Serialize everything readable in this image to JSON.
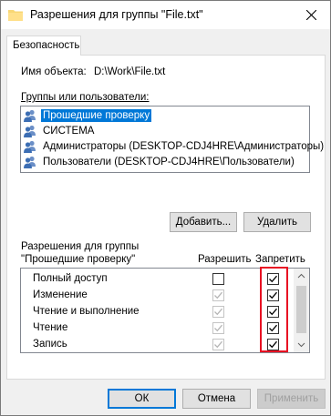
{
  "window": {
    "title": "Разрешения для группы \"File.txt\""
  },
  "tabs": [
    {
      "label": "Безопасность",
      "active": true
    }
  ],
  "object": {
    "label": "Имя объекта:",
    "value": "D:\\Work\\File.txt"
  },
  "groups": {
    "label": "Группы или пользователи:",
    "items": [
      {
        "label": "Прошедшие проверку",
        "selected": true
      },
      {
        "label": "СИСТЕМА",
        "selected": false
      },
      {
        "label": "Администраторы (DESKTOP-CDJ4HRE\\Администраторы)",
        "selected": false
      },
      {
        "label": "Пользователи (DESKTOP-CDJ4HRE\\Пользователи)",
        "selected": false
      }
    ]
  },
  "buttons": {
    "add": "Добавить...",
    "remove": "Удалить",
    "ok": "ОК",
    "cancel": "Отмена",
    "apply": "Применить"
  },
  "permissions": {
    "header_line1": "Разрешения для группы",
    "header_line2": "\"Прошедшие проверку\"",
    "allow_label": "Разрешить",
    "deny_label": "Запретить",
    "rows": [
      {
        "name": "Полный доступ",
        "allow": false,
        "allow_disabled": false,
        "deny": true
      },
      {
        "name": "Изменение",
        "allow": true,
        "allow_disabled": true,
        "deny": true
      },
      {
        "name": "Чтение и выполнение",
        "allow": true,
        "allow_disabled": true,
        "deny": true
      },
      {
        "name": "Чтение",
        "allow": true,
        "allow_disabled": true,
        "deny": true
      },
      {
        "name": "Запись",
        "allow": true,
        "allow_disabled": true,
        "deny": true
      }
    ]
  },
  "colors": {
    "selection": "#0078d7",
    "highlight_box": "#e81123",
    "dialog_bg": "#f0f0f0"
  }
}
